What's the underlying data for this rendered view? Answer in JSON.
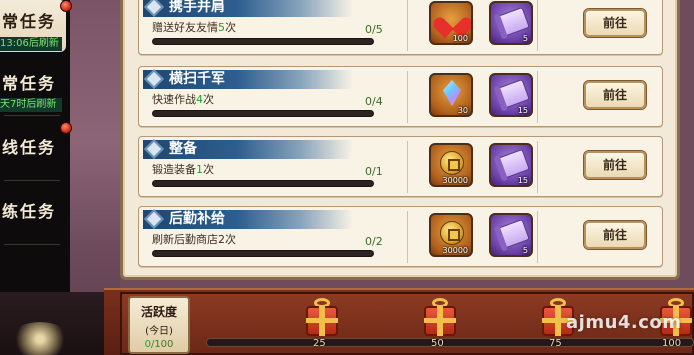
{
  "tabs": [
    {
      "label": "常任务",
      "timer": "13:06后刷新",
      "active": true
    },
    {
      "label": "常任务",
      "timer": "天7时后刷新",
      "active": false
    },
    {
      "label": "线任务",
      "active": false
    },
    {
      "label": "练任务",
      "active": false
    }
  ],
  "tasks": [
    {
      "title": "携手并肩",
      "desc_prefix": "赠送好友友情",
      "desc_num": "5",
      "desc_suffix": "次",
      "progress": "0/5",
      "progress_fraction": 0,
      "rewards": [
        {
          "icon": "heart-icon",
          "count": "100"
        },
        {
          "icon": "scroll-icon",
          "count": "5"
        }
      ],
      "button": "前往"
    },
    {
      "title": "横扫千军",
      "desc_prefix": "快速作战",
      "desc_num": "4",
      "desc_suffix": "次",
      "progress": "0/4",
      "progress_fraction": 0,
      "rewards": [
        {
          "icon": "crystal-icon",
          "count": "30"
        },
        {
          "icon": "scroll-icon",
          "count": "15"
        }
      ],
      "button": "前往"
    },
    {
      "title": "整备",
      "desc_prefix": "锻造装备",
      "desc_num": "1",
      "desc_suffix": "次",
      "progress": "0/1",
      "progress_fraction": 0,
      "rewards": [
        {
          "icon": "coin-icon",
          "count": "30000"
        },
        {
          "icon": "scroll-icon",
          "count": "15"
        }
      ],
      "button": "前往"
    },
    {
      "title": "后勤补给",
      "desc_prefix": "刷新后勤商店2次",
      "desc_num": "",
      "desc_suffix": "",
      "progress": "0/2",
      "progress_fraction": 0,
      "rewards": [
        {
          "icon": "coin-icon",
          "count": "30000"
        },
        {
          "icon": "scroll-icon",
          "count": "5"
        }
      ],
      "button": "前往"
    }
  ],
  "activity": {
    "title": "活跃度",
    "subtitle": "(今日)",
    "current": "0",
    "max": "/100",
    "milestones": [
      "25",
      "50",
      "75",
      "100"
    ]
  },
  "watermark": "ajmu4.com",
  "colors": {
    "accent_green": "#2b9b2b",
    "title_blue": "#1f4770",
    "notify_red": "#d0301a"
  }
}
